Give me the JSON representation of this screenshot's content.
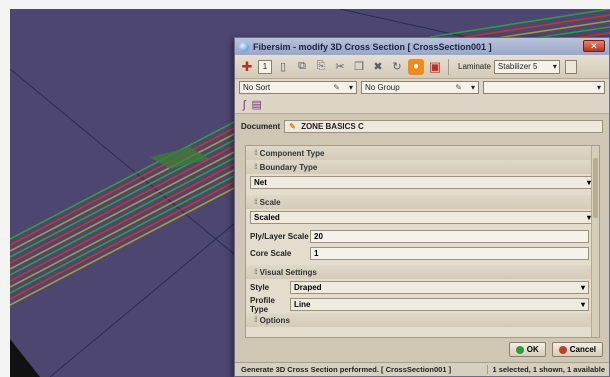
{
  "dialog": {
    "title": "Fibersim - modify 3D Cross Section [ CrossSection001 ]",
    "close_label": "✕"
  },
  "toolbar": {
    "count": "1",
    "laminate_label": "Laminate",
    "laminate_value": "Stabilizer 5"
  },
  "filters": {
    "sort": "No Sort",
    "group": "No Group",
    "blank": ""
  },
  "document": {
    "label": "Document",
    "value": "ZONE BASICS C"
  },
  "sections": {
    "component_type": "Component Type",
    "boundary_type": "Boundary Type",
    "boundary_value": "Net",
    "scale": "Scale",
    "scale_value": "Scaled",
    "ply_scale_label": "Ply/Layer Scale",
    "ply_scale_value": "20",
    "core_scale_label": "Core Scale",
    "core_scale_value": "1",
    "visual_settings": "Visual Settings",
    "style_label": "Style",
    "style_value": "Draped",
    "profile_label": "Profile Type",
    "profile_value": "Line",
    "options": "Options"
  },
  "buttons": {
    "ok": "OK",
    "cancel": "Cancel"
  },
  "status": {
    "message": "Generate 3D Cross Section performed. [ CrossSection001 ]",
    "selection": "1 selected, 1 shown, 1 available"
  },
  "colors": {
    "viewport_bg": "#4d4670",
    "dialog_bg": "#cfc6b4",
    "stripe_red": "#c0392b",
    "stripe_green": "#2e9e3e",
    "stripe_yellow": "#a89a3a"
  }
}
